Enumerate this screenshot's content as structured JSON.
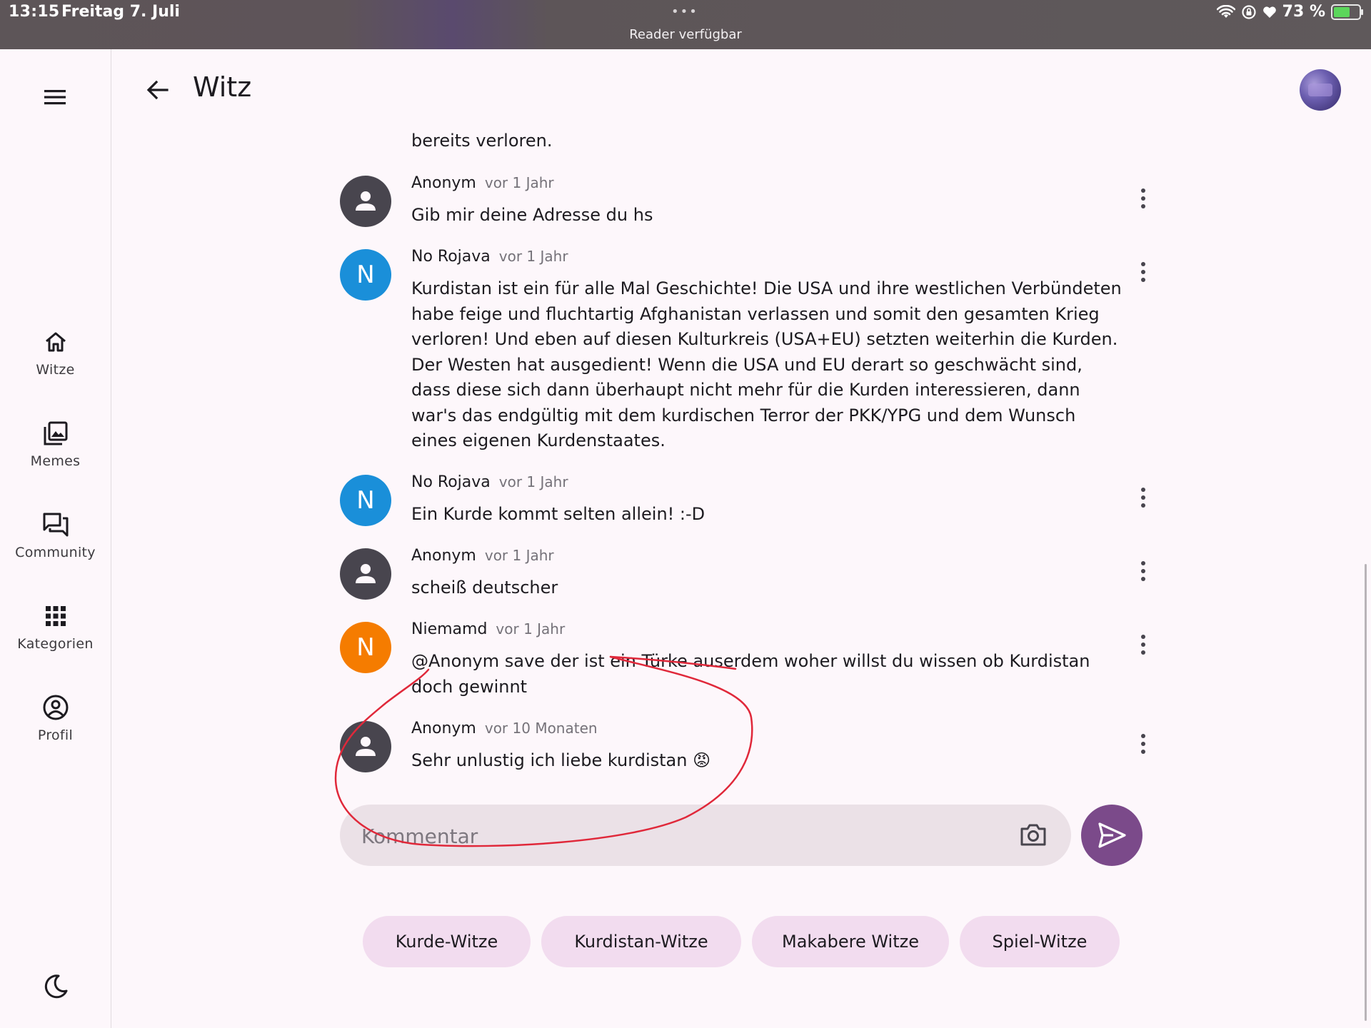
{
  "status_bar": {
    "time": "13:15",
    "date": "Freitag 7. Juli",
    "dots": "•••",
    "reader": "Reader verfügbar",
    "battery": "73 %",
    "battery_level": 0.73
  },
  "rail": {
    "items": [
      {
        "label": "Witze",
        "icon": "home-icon"
      },
      {
        "label": "Memes",
        "icon": "image-library-icon"
      },
      {
        "label": "Community",
        "icon": "forum-icon"
      },
      {
        "label": "Kategorien",
        "icon": "apps-grid-icon"
      },
      {
        "label": "Profil",
        "icon": "account-circle-icon"
      }
    ],
    "theme_icon": "dark-mode-moon-icon"
  },
  "header": {
    "title": "Witz"
  },
  "fragment_text": "bereits verloren.",
  "comments": [
    {
      "author": "Anonym",
      "time": "vor 1 Jahr",
      "avatar": "person-icon",
      "text": "Gib mir deine Adresse du hs"
    },
    {
      "author": "No Rojava",
      "time": "vor 1 Jahr",
      "avatar_letter": "N",
      "avatar_color": "#1a8fd9",
      "text": "Kurdistan ist ein für alle Mal Geschichte! Die USA und ihre westlichen Verbündeten habe feige und fluchtartig Afghanistan verlassen und somit den gesamten Krieg verloren! Und eben auf diesen Kulturkreis (USA+EU) setzten weiterhin die Kurden. Der Westen hat ausgedient! Wenn die USA und EU derart so geschwächt sind, dass diese sich dann überhaupt nicht mehr für die Kurden interessieren, dann war's das endgültig mit dem kurdischen Terror der PKK/YPG und dem Wunsch eines eigenen Kurdenstaates."
    },
    {
      "author": "No Rojava",
      "time": "vor 1 Jahr",
      "avatar_letter": "N",
      "avatar_color": "#1a8fd9",
      "text": "Ein Kurde kommt selten allein! :-D"
    },
    {
      "author": "Anonym",
      "time": "vor 1 Jahr",
      "avatar": "person-icon",
      "text": "scheiß deutscher"
    },
    {
      "author": "Niemamd",
      "time": "vor 1 Jahr",
      "avatar_letter": "N",
      "avatar_color": "#f57c00",
      "text": "@Anonym save der ist ein Türke auserdem woher willst du wissen ob Kurdistan doch gewinnt"
    },
    {
      "author": "Anonym",
      "time": "vor 10 Monaten",
      "avatar": "person-icon",
      "text": "Sehr unlustig ich liebe kurdistan 😡"
    }
  ],
  "comment_input": {
    "placeholder": "Kommentar",
    "value": ""
  },
  "chips": [
    {
      "label": "Kurde-Witze"
    },
    {
      "label": "Kurdistan-Witze"
    },
    {
      "label": "Makabere Witze"
    },
    {
      "label": "Spiel-Witze"
    }
  ],
  "colors": {
    "background": "#fdf7fb",
    "accent": "#7b4a8a",
    "chip": "#f2dcef",
    "annotation": "#e0283a"
  }
}
